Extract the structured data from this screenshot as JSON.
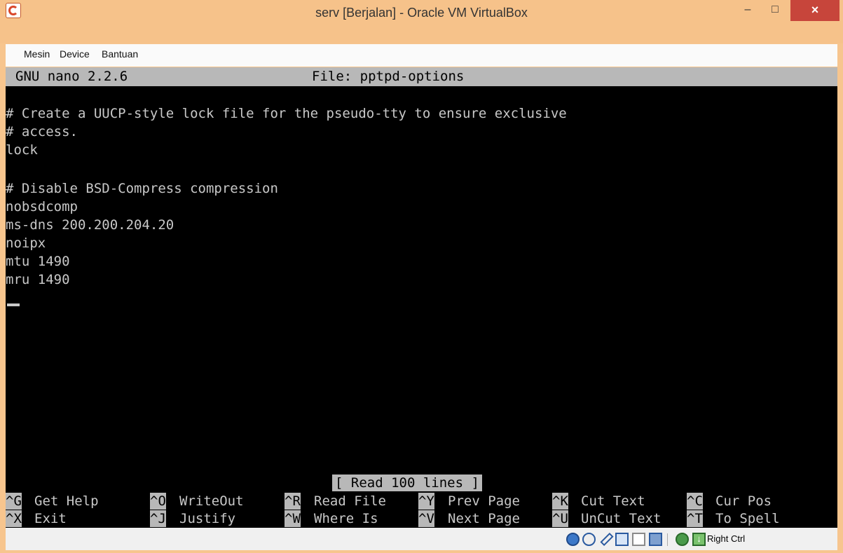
{
  "window": {
    "title": "serv [Berjalan] - Oracle VM VirtualBox",
    "min": "–",
    "max": "□",
    "close": "×"
  },
  "menu": [
    "Mesin",
    "Device",
    "Bantuan"
  ],
  "nano": {
    "version": "GNU nano 2.2.6",
    "file": "File: pptpd-options",
    "lines": [
      "",
      "# Create a UUCP-style lock file for the pseudo-tty to ensure exclusive",
      "# access.",
      "lock",
      "",
      "# Disable BSD-Compress compression",
      "nobsdcomp",
      "ms-dns 200.200.204.20",
      "noipx",
      "mtu 1490",
      "mru 1490"
    ],
    "status": "[ Read 100 lines ]",
    "shortcuts_row1": [
      {
        "key": "^G",
        "label": "Get Help"
      },
      {
        "key": "^O",
        "label": "WriteOut"
      },
      {
        "key": "^R",
        "label": "Read File"
      },
      {
        "key": "^Y",
        "label": "Prev Page"
      },
      {
        "key": "^K",
        "label": "Cut Text"
      },
      {
        "key": "^C",
        "label": "Cur Pos"
      }
    ],
    "shortcuts_row2": [
      {
        "key": "^X",
        "label": "Exit"
      },
      {
        "key": "^J",
        "label": "Justify"
      },
      {
        "key": "^W",
        "label": "Where Is"
      },
      {
        "key": "^V",
        "label": "Next Page"
      },
      {
        "key": "^U",
        "label": "UnCut Text"
      },
      {
        "key": "^T",
        "label": "To Spell"
      }
    ]
  },
  "statusbar": {
    "icons": [
      "hard-disk-icon",
      "optical-drive-icon",
      "usb-icon",
      "network-icon",
      "shared-folder-icon",
      "display-icon",
      "mouse-integration-icon",
      "keyboard-capture-icon"
    ],
    "host_key": "Right Ctrl"
  }
}
